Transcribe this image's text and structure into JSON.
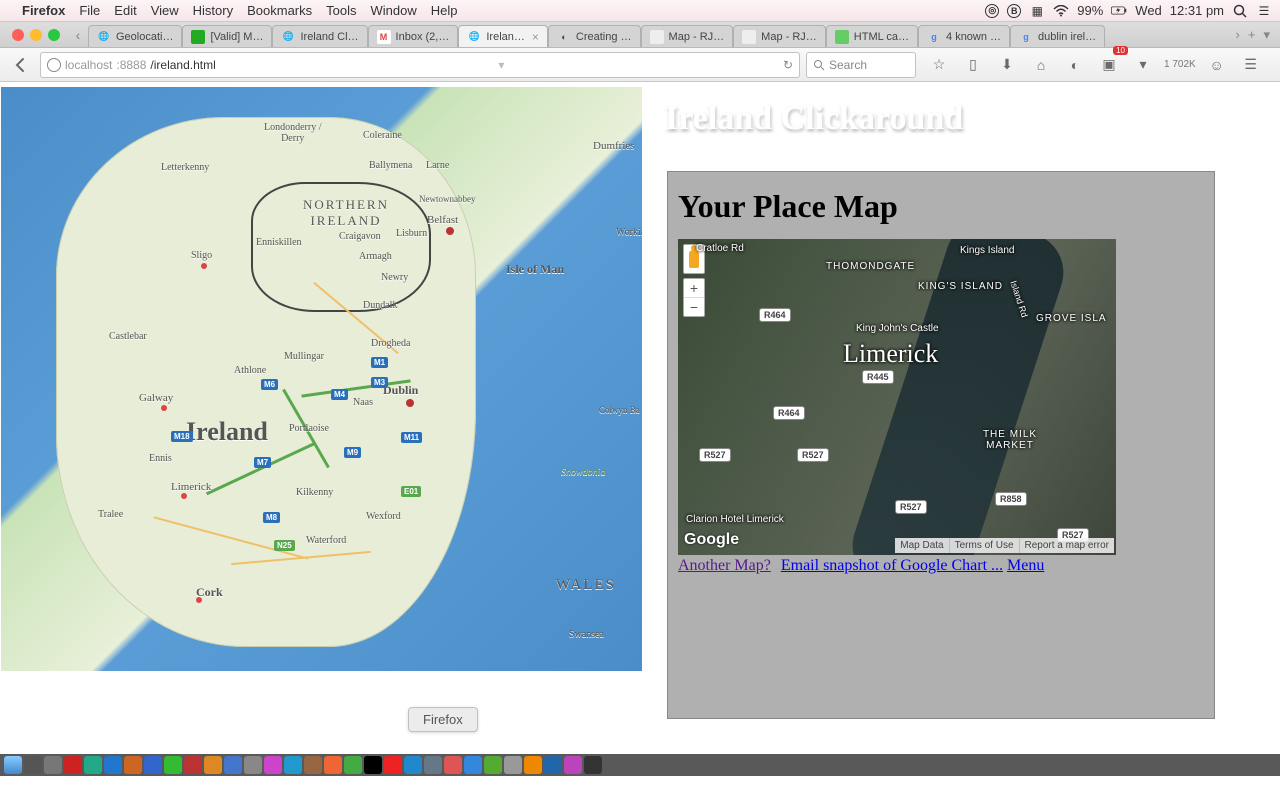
{
  "menubar": {
    "app": "Firefox",
    "items": [
      "File",
      "Edit",
      "View",
      "History",
      "Bookmarks",
      "Tools",
      "Window",
      "Help"
    ],
    "battery": "99%",
    "day": "Wed",
    "time": "12:31 pm"
  },
  "tabs": {
    "list": [
      {
        "label": "Geolocati…",
        "fav": "globe"
      },
      {
        "label": "[Valid] M…",
        "fav": "green"
      },
      {
        "label": "Ireland Cl…",
        "fav": "globe"
      },
      {
        "label": "Inbox (2,…",
        "fav": "gmail"
      },
      {
        "label": "Irelan…",
        "fav": "globe",
        "active": true,
        "closable": true
      },
      {
        "label": "Creating …",
        "fav": "chrome"
      },
      {
        "label": "Map - RJ…",
        "fav": "rj"
      },
      {
        "label": "Map - RJ…",
        "fav": "rj"
      },
      {
        "label": "HTML ca…",
        "fav": "w3"
      },
      {
        "label": "4 known …",
        "fav": "google"
      },
      {
        "label": "dublin irel…",
        "fav": "google"
      }
    ]
  },
  "toolbar": {
    "url_host": "localhost",
    "url_port": ":8888",
    "url_path": "/ireland.html",
    "search_placeholder": "Search",
    "counter": "1 702K"
  },
  "page": {
    "title": "Ireland Clickaround",
    "panel_heading": "Your Place Map",
    "links": {
      "another": "Another Map?",
      "email": "Email snapshot of Google Chart ...",
      "menu": "Menu"
    }
  },
  "ireland_map": {
    "country": "Ireland",
    "ni": "NORTHERN IRELAND",
    "wales": "WALES",
    "iom": "Isle of Man",
    "cities": {
      "dublin": "Dublin",
      "belfast": "Belfast",
      "cork": "Cork",
      "galway": "Galway",
      "limerick": "Limerick",
      "derry": "Londonderry /\nDerry",
      "sligo": "Sligo",
      "waterford": "Waterford",
      "wexford": "Wexford",
      "kilkenny": "Kilkenny",
      "tralee": "Tralee",
      "ennis": "Ennis",
      "athlone": "Athlone",
      "mullingar": "Mullingar",
      "drogheda": "Drogheda",
      "dundalk": "Dundalk",
      "letterkenny": "Letterkenny",
      "coleraine": "Coleraine",
      "castlebar": "Castlebar",
      "portlaoise": "Portlaoise",
      "naas": "Naas",
      "lisburn": "Lisburn",
      "armagh": "Armagh",
      "newry": "Newry",
      "enniskillen": "Enniskillen",
      "ballymena": "Ballymena",
      "larne": "Larne",
      "newtownabbey": "Newtownabbey",
      "craigavon": "Craigavon",
      "swansea": "Swansea",
      "snowdonia": "Snowdonia",
      "colwyn": "Colwyn Ba",
      "dumfries": "Dumfries",
      "workin": "Workin"
    },
    "roads": {
      "m1": "M1",
      "m4": "M4",
      "m6": "M6",
      "m7": "M7",
      "m8": "M8",
      "m9": "M9",
      "m11": "M11",
      "m18": "M18",
      "m3": "M3",
      "n25": "N25",
      "e01": "E01"
    }
  },
  "satmap": {
    "city": "Limerick",
    "labels": {
      "thomondgate": "THOMONDGATE",
      "kingsisland_area": "KING'S ISLAND",
      "kingsisland": "Kings Island",
      "groveisla": "GROVE ISLA",
      "milkmarket": "THE MILK MARKET",
      "castle": "King John's Castle",
      "cratloe": "Cratloe Rd",
      "clarion": "Clarion Hotel Limerick",
      "islandrd": "Island Rd"
    },
    "roads": {
      "r464": "R464",
      "r445": "R445",
      "r527": "R527",
      "r858": "R858"
    },
    "footer": {
      "mapdata": "Map Data",
      "terms": "Terms of Use",
      "report": "Report a map error"
    },
    "logo": "Google"
  },
  "dock": {
    "tooltip": "Firefox"
  }
}
